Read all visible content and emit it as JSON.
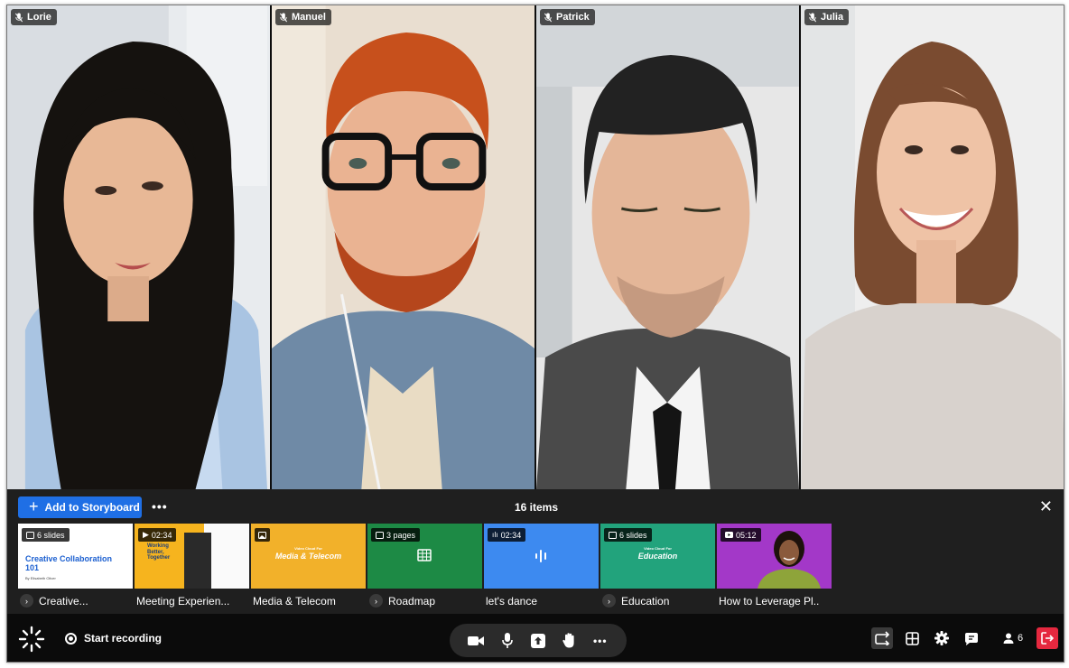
{
  "participants": [
    {
      "name": "Lorie",
      "muted": true
    },
    {
      "name": "Manuel",
      "muted": true
    },
    {
      "name": "Patrick",
      "muted": true
    },
    {
      "name": "Julia",
      "muted": true
    }
  ],
  "storyboard": {
    "add_label": "Add to Storyboard",
    "more_label": "•••",
    "count_label": "16 items",
    "close_label": "✕",
    "items": [
      {
        "title": "Creative...",
        "tag": "6 slides",
        "tag_icon": "slides-icon",
        "has_chevron": true,
        "thumb_title": "Creative Collaboration 101",
        "thumb_sub": "By Elisabeth Oliver"
      },
      {
        "title": "Meeting Experien...",
        "tag": "02:34",
        "tag_icon": "play-icon",
        "has_chevron": false,
        "thumb_title": "Working Better, Together"
      },
      {
        "title": "Media & Telecom",
        "tag": "",
        "tag_icon": "image-icon",
        "has_chevron": false,
        "thumb_title": "Media & Telecom",
        "thumb_sub": "Video Cloud For"
      },
      {
        "title": "Roadmap",
        "tag": "3 pages",
        "tag_icon": "pages-icon",
        "has_chevron": true
      },
      {
        "title": "let's dance",
        "tag": "02:34",
        "tag_icon": "audio-icon",
        "has_chevron": false
      },
      {
        "title": "Education",
        "tag": "6 slides",
        "tag_icon": "slides-icon",
        "has_chevron": true,
        "thumb_title": "Education",
        "thumb_sub": "Video Cloud For"
      },
      {
        "title": "How to Leverage Pl..",
        "tag": "05:12",
        "tag_icon": "video-icon",
        "has_chevron": false
      }
    ]
  },
  "toolbar": {
    "record_label": "Start recording",
    "participant_count": "6"
  },
  "colors": {
    "accent": "#1f6fe5",
    "leave": "#e5283f",
    "card_yellow": "#f6b41e",
    "card_green": "#1d8a45",
    "card_blue": "#3d8af0",
    "card_teal": "#22a37c",
    "card_purple": "#a338c8"
  }
}
